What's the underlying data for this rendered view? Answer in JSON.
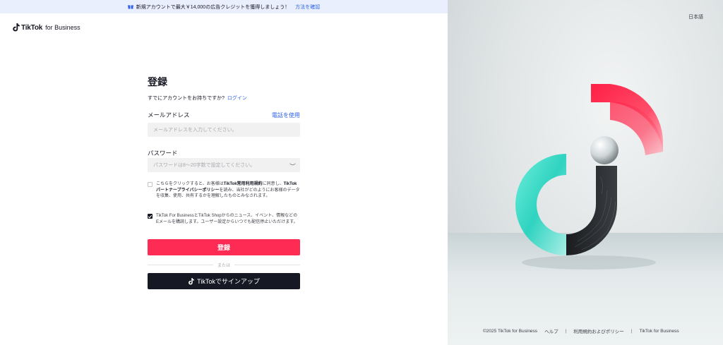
{
  "banner": {
    "text": "新規アカウントで最大￥14,000の広告クレジットを獲得しましょう！",
    "link": "方法を確認"
  },
  "logo": {
    "brand": "TikTok",
    "suffix": "for Business"
  },
  "form": {
    "title": "登録",
    "subtitle": "すでにアカウントをお持ちですか?",
    "login_link": "ログイン",
    "email_label": "メールアドレス",
    "use_phone": "電話を使用",
    "email_placeholder": "メールアドレスを入力してください。",
    "password_label": "パスワード",
    "password_placeholder": "パスワードは8～20字数で設定してください。",
    "consent_pre": "こちらをクリックすると、お客様は",
    "consent_terms": "TikTok常用利用規約",
    "consent_mid": "に同意し、",
    "consent_policy": "TikTokパートナープライバシーポリシー",
    "consent_post": "を読み、当社がどのようにお客様のデータを収集、使用、共有するかを理解したものとみなされます。",
    "marketing_text": "TikTok For BusinessとTikTok Shopからのニュース、イベント、情報などのEメールを購読します。ユーザー設定からいつでも配信停止いただけます。",
    "marketing_checked": true,
    "register_button": "登録",
    "or_text": "または",
    "tiktok_signup": "TikTokでサインアップ"
  },
  "right": {
    "language": "日本語",
    "footer": {
      "copyright": "©2025 TikTok for Business",
      "help": "ヘルプ",
      "terms": "利用規約およびポリシー",
      "brand": "TikTok for Business"
    }
  },
  "colors": {
    "accent": "#fe2c55",
    "link": "#2f62e6",
    "dark": "#161823",
    "banner_bg": "#e9effd"
  }
}
